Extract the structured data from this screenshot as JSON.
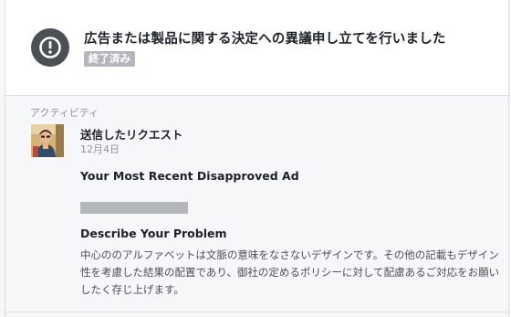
{
  "header": {
    "title": "広告または製品に関する決定への異議申し立てを行いました",
    "status_badge": "終了済み",
    "icon": "alert-icon"
  },
  "activity": {
    "section_label": "アクティビティ",
    "request_title": "送信したリクエスト",
    "request_date": "12月4日",
    "ad_heading": "Your Most Recent Disapproved Ad",
    "problem_heading": "Describe Your Problem",
    "problem_text": "中心ののアルファベットは文脈の意味をなさないデザインです。その他の記載もデザイン性を考慮した結果の配置であり、御社の定めるポリシーに対して配慮あるご対応をお願いしたく存じ上げます。"
  },
  "colors": {
    "icon_bg": "#4b4f56",
    "badge_bg": "#b3b6bb",
    "page_bg": "#f6f7f9"
  }
}
